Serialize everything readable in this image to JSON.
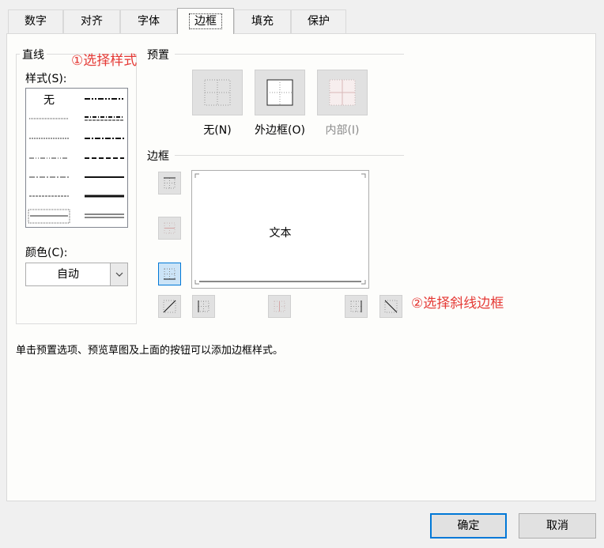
{
  "tabs": [
    "数字",
    "对齐",
    "字体",
    "边框",
    "填充",
    "保护"
  ],
  "active_tab": "边框",
  "line_group": {
    "title": "直线",
    "style_label": "样式(S):",
    "style_none": "无",
    "color_label": "颜色(C):",
    "color_value": "自动"
  },
  "preset": {
    "title": "预置",
    "none_label": "无(N)",
    "outline_label": "外边框(O)",
    "inside_label": "内部(I)"
  },
  "border": {
    "title": "边框",
    "preview_text": "文本"
  },
  "hint": "单击预置选项、预览草图及上面的按钮可以添加边框样式。",
  "annotations": {
    "step1": "①选择样式",
    "step2": "②选择斜线边框"
  },
  "buttons": {
    "ok": "确定",
    "cancel": "取消"
  },
  "colors": {
    "annotation": "#e53935",
    "selected": "#cce4f7",
    "focus": "#0078d7"
  }
}
